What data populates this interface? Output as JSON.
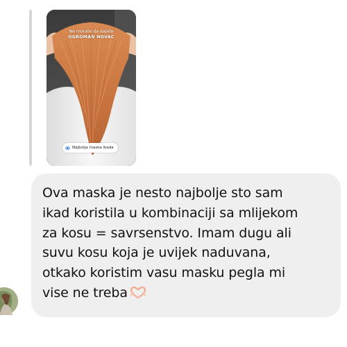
{
  "story_reply": {
    "caption_line1": "Ne morate da dajete",
    "caption_line2": "OGROMAN NOVAC",
    "chip_label": "Najbolja maska ikada"
  },
  "message": {
    "lines": [
      "Ova maska je nesto najbolje sto sam",
      "ikad koristila u kombinaciji sa mlijekom",
      "za kosu = savrsenstvo. Imam dugu ali",
      "suvu kosu koja je uvijek naduvana,",
      "otkako koristim vasu masku pegla mi",
      "vise ne treba"
    ],
    "emoji": "heart-hands-icon"
  },
  "colors": {
    "bubble_bg": "#efeff0",
    "text": "#111111",
    "reply_bar": "#d6d6d6",
    "hair": "#c8733f",
    "emoji": "#f5b8a0"
  },
  "icons": {
    "avatar": "sender-avatar",
    "chip": "link-icon"
  }
}
